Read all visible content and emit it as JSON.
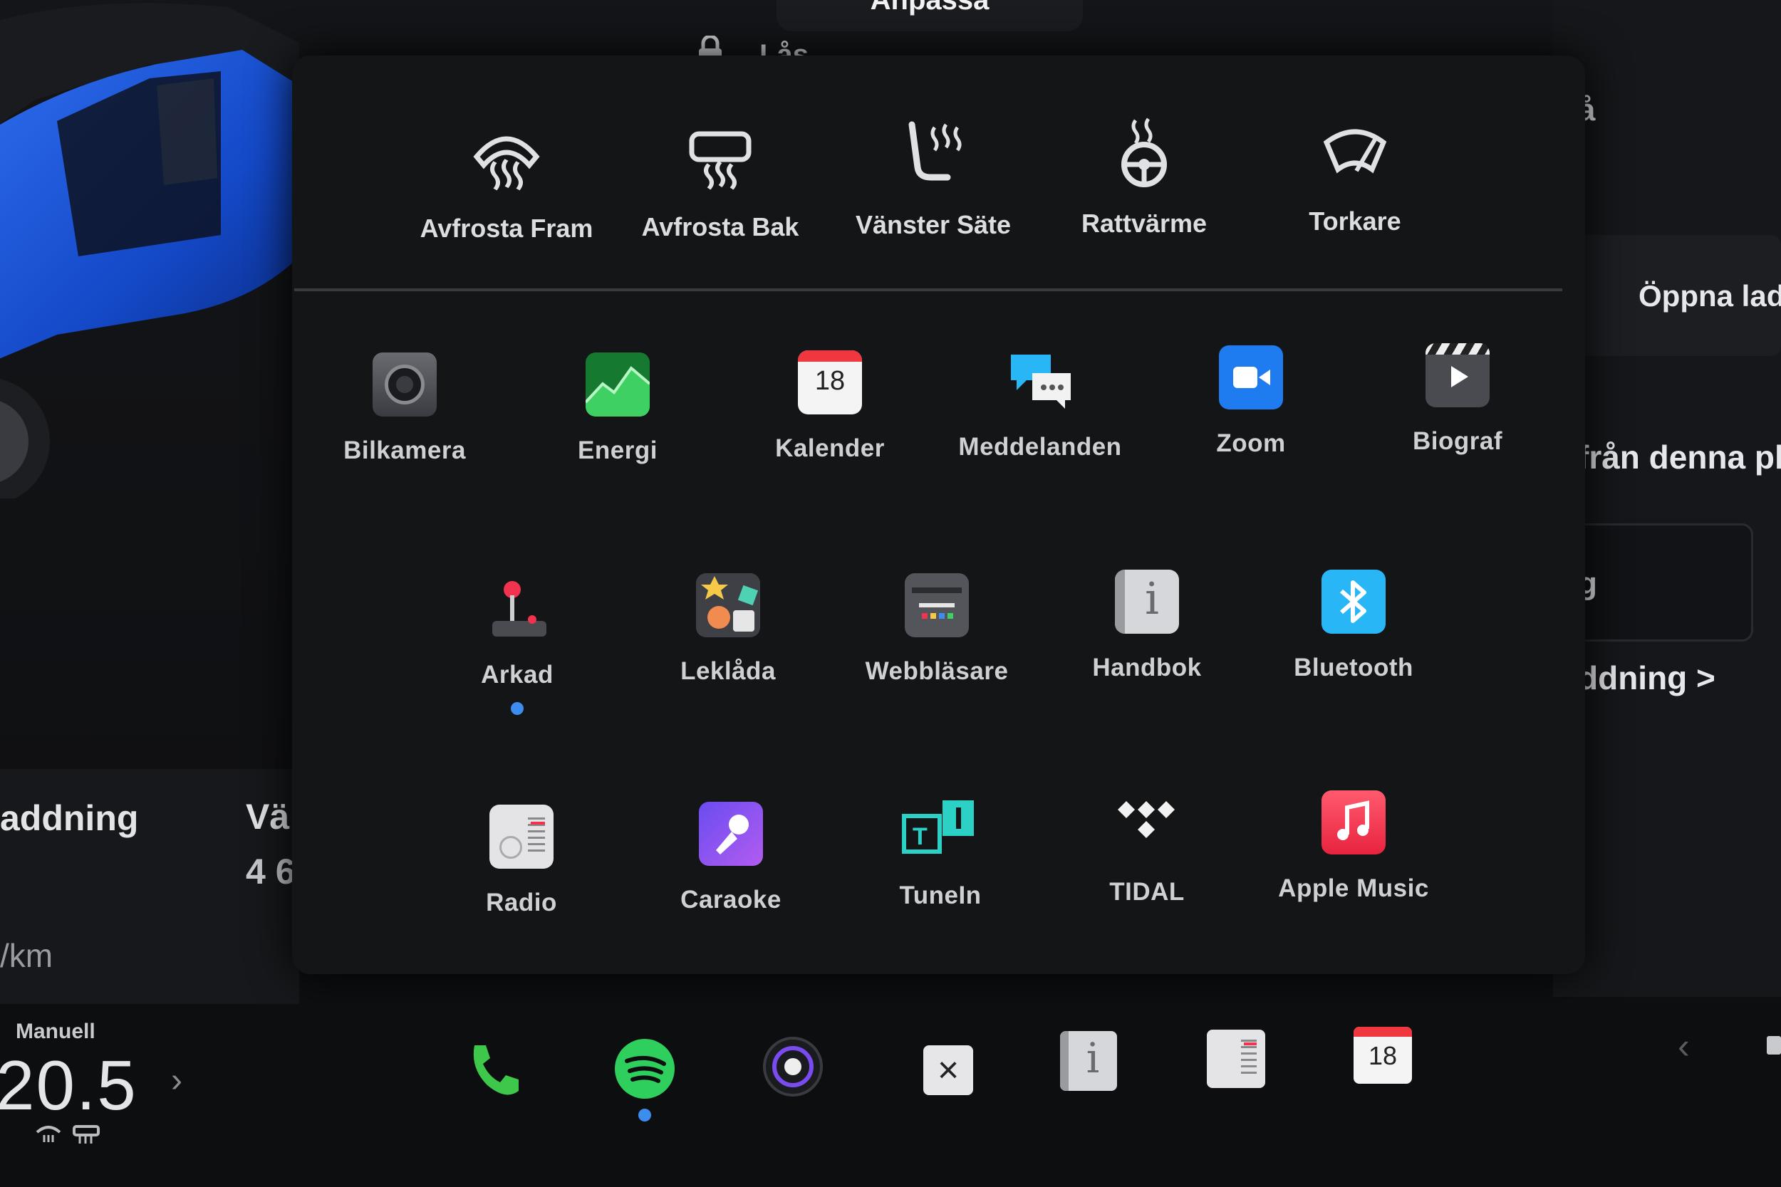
{
  "header": {
    "title": "Anpassa",
    "lock_label": "Lås"
  },
  "quick_controls": [
    {
      "label": "Avfrosta Fram",
      "icon": "front-defrost-icon"
    },
    {
      "label": "Avfrosta Bak",
      "icon": "rear-defrost-icon"
    },
    {
      "label": "Vänster Säte",
      "icon": "seat-heater-icon"
    },
    {
      "label": "Rattvärme",
      "icon": "steering-wheel-heat-icon"
    },
    {
      "label": "Torkare",
      "icon": "wiper-icon"
    }
  ],
  "apps": [
    {
      "label": "Bilkamera",
      "icon": "camera-icon"
    },
    {
      "label": "Energi",
      "icon": "energy-icon"
    },
    {
      "label": "Kalender",
      "icon": "calendar-icon",
      "badge": "18"
    },
    {
      "label": "Meddelanden",
      "icon": "messages-icon"
    },
    {
      "label": "Zoom",
      "icon": "zoom-icon"
    },
    {
      "label": "Biograf",
      "icon": "theater-icon"
    },
    {
      "label": "Arkad",
      "icon": "arcade-icon",
      "indicator": true
    },
    {
      "label": "Leklåda",
      "icon": "toybox-icon"
    },
    {
      "label": "Webbläsare",
      "icon": "browser-icon"
    },
    {
      "label": "Handbok",
      "icon": "manual-icon"
    },
    {
      "label": "Bluetooth",
      "icon": "bluetooth-icon"
    },
    {
      "label": "Radio",
      "icon": "radio-icon"
    },
    {
      "label": "Caraoke",
      "icon": "caraoke-icon"
    },
    {
      "label": "TuneIn",
      "icon": "tunein-icon"
    },
    {
      "label": "TIDAL",
      "icon": "tidal-icon"
    },
    {
      "label": "Apple Music",
      "icon": "apple-music-icon"
    }
  ],
  "right_panel": {
    "top_fragment": "å",
    "open_label": "Öppna lad",
    "from_label": "från denna pl",
    "input_fragment": "g",
    "link_fragment": "ddning >"
  },
  "left_panel": {
    "charge_fragment": "addning",
    "col_fragment": "Vä",
    "value_fragment": "4 6",
    "unit_fragment": "/km"
  },
  "dock": {
    "climate_mode": "Manuell",
    "temperature": "20.5",
    "calendar_badge": "18",
    "items": [
      "phone-icon",
      "spotify-icon",
      "dashcam-icon",
      "close-icon",
      "manual-icon",
      "radio-icon",
      "calendar-icon"
    ]
  },
  "colors": {
    "accent_blue": "#3d8cf0",
    "energy_green": "#2fbf4c",
    "zoom_blue": "#1f7cf0",
    "apple_music_red": "#f2334f",
    "spotify_green": "#2fcf5e",
    "phone_green": "#3ec84b"
  }
}
